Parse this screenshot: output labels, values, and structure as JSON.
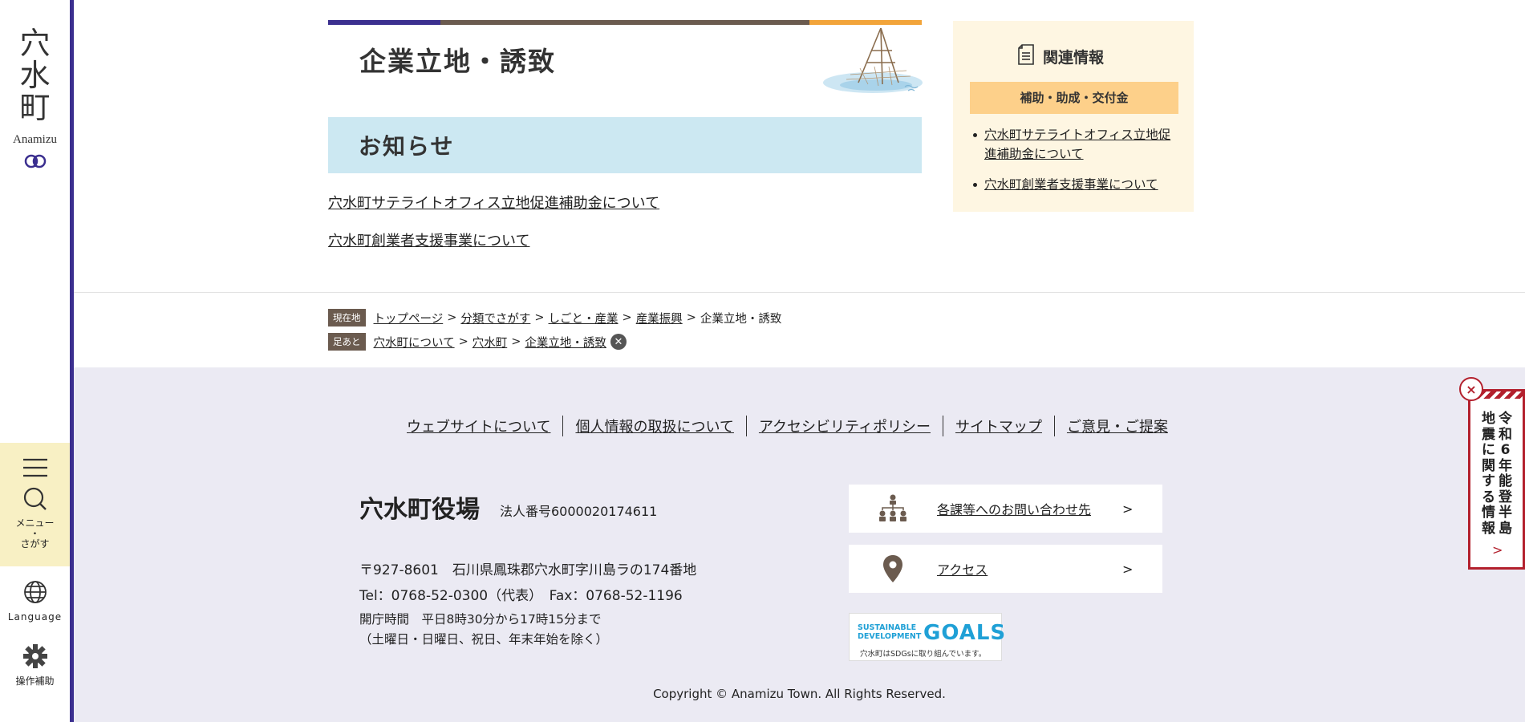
{
  "sidebar": {
    "logo_kanji": [
      "穴",
      "水",
      "町"
    ],
    "logo_roman": "Anamizu",
    "menu_label_1": "メニュー",
    "menu_label_dot": "・",
    "menu_label_2": "さがす",
    "language_label": "Language",
    "assist_label": "操作補助"
  },
  "colors": {
    "sidebar_border": "#3b2f8f",
    "title_bar": [
      "#3b2f8f",
      "#6b5b4f",
      "#f2a43a"
    ],
    "notice_bg": "#cce8f2",
    "related_bg": "#fef6e2",
    "related_sub_bg": "#fdd08a",
    "footer_bg": "#ebeaf3",
    "quake_red": "#b3202d"
  },
  "main": {
    "title": "企業立地・誘致",
    "notice_heading": "お知らせ",
    "notice_links": [
      "穴水町サテライトオフィス立地促進補助金について",
      "穴水町創業者支援事業について"
    ]
  },
  "related": {
    "heading": "関連情報",
    "subheading": "補助・助成・交付金",
    "links": [
      "穴水町サテライトオフィス立地促進補助金について",
      "穴水町創業者支援事業について"
    ]
  },
  "breadcrumb": {
    "current_tag": "現在地",
    "current": [
      "トップページ",
      "分類でさがす",
      "しごと・産業",
      "産業振興"
    ],
    "current_last": "企業立地・誘致",
    "history_tag": "足あと",
    "history": [
      "穴水町について",
      "穴水町",
      "企業立地・誘致"
    ],
    "separator": ">"
  },
  "footer": {
    "nav": [
      "ウェブサイトについて",
      "個人情報の取扱について",
      "アクセシビリティポリシー",
      "サイトマップ",
      "ご意見・ご提案"
    ],
    "office_name": "穴水町役場",
    "corp_number": "法人番号6000020174611",
    "address": "〒927-8601　石川県鳳珠郡穴水町字川島ラの174番地",
    "tel": "Tel：0768-52-0300（代表）　Fax：0768-52-1196",
    "hours_1": "開庁時間　平日8時30分から17時15分まで",
    "hours_2": "（土曜日・日曜日、祝日、年末年始を除く）",
    "card_contact": "各課等へのお問い合わせ先",
    "card_access": "アクセス",
    "card_chevron": ">",
    "sdgs_line1": "SUSTAINABLE",
    "sdgs_line2": "DEVELOPMENT",
    "sdgs_goals": "GOALS",
    "sdgs_caption": "穴水町はSDGsに取り組んでいます。",
    "copyright": "Copyright © Anamizu Town. All Rights Reserved."
  },
  "quake_banner": {
    "col1": [
      "令",
      "和",
      "6",
      "年",
      "能",
      "登",
      "半",
      "島"
    ],
    "col2": [
      "地",
      "震",
      "に",
      "関",
      "す",
      "る",
      "情",
      "報"
    ],
    "arrow": ">",
    "close": "×"
  }
}
